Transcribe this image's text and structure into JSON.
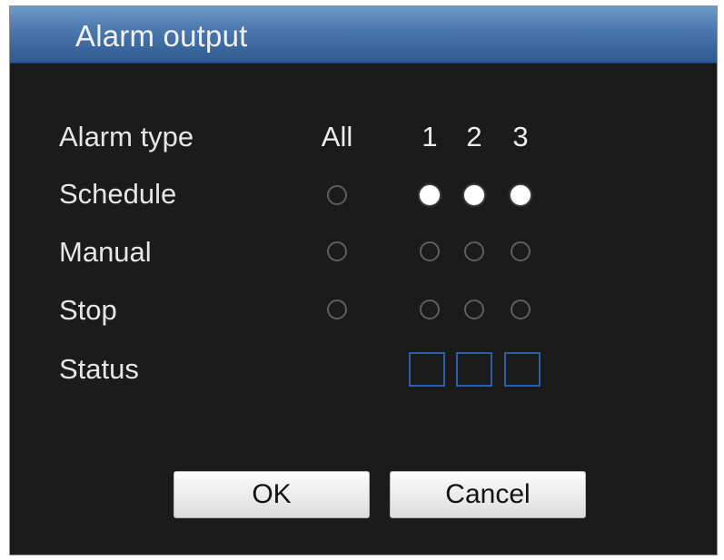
{
  "dialog": {
    "title": "Alarm output",
    "accent_color": "#4c79ad",
    "background_color": "#1b1b1b"
  },
  "rows": {
    "alarm_type": "Alarm type",
    "schedule": "Schedule",
    "manual": "Manual",
    "stop": "Stop",
    "status": "Status"
  },
  "columns": {
    "all": "All",
    "c1": "1",
    "c2": "2",
    "c3": "3"
  },
  "selection": {
    "all": "none",
    "output_1": "Schedule",
    "output_2": "Schedule",
    "output_3": "Schedule"
  },
  "status_indicator_color": "#2e5fa6",
  "buttons": {
    "ok": "OK",
    "cancel": "Cancel"
  }
}
